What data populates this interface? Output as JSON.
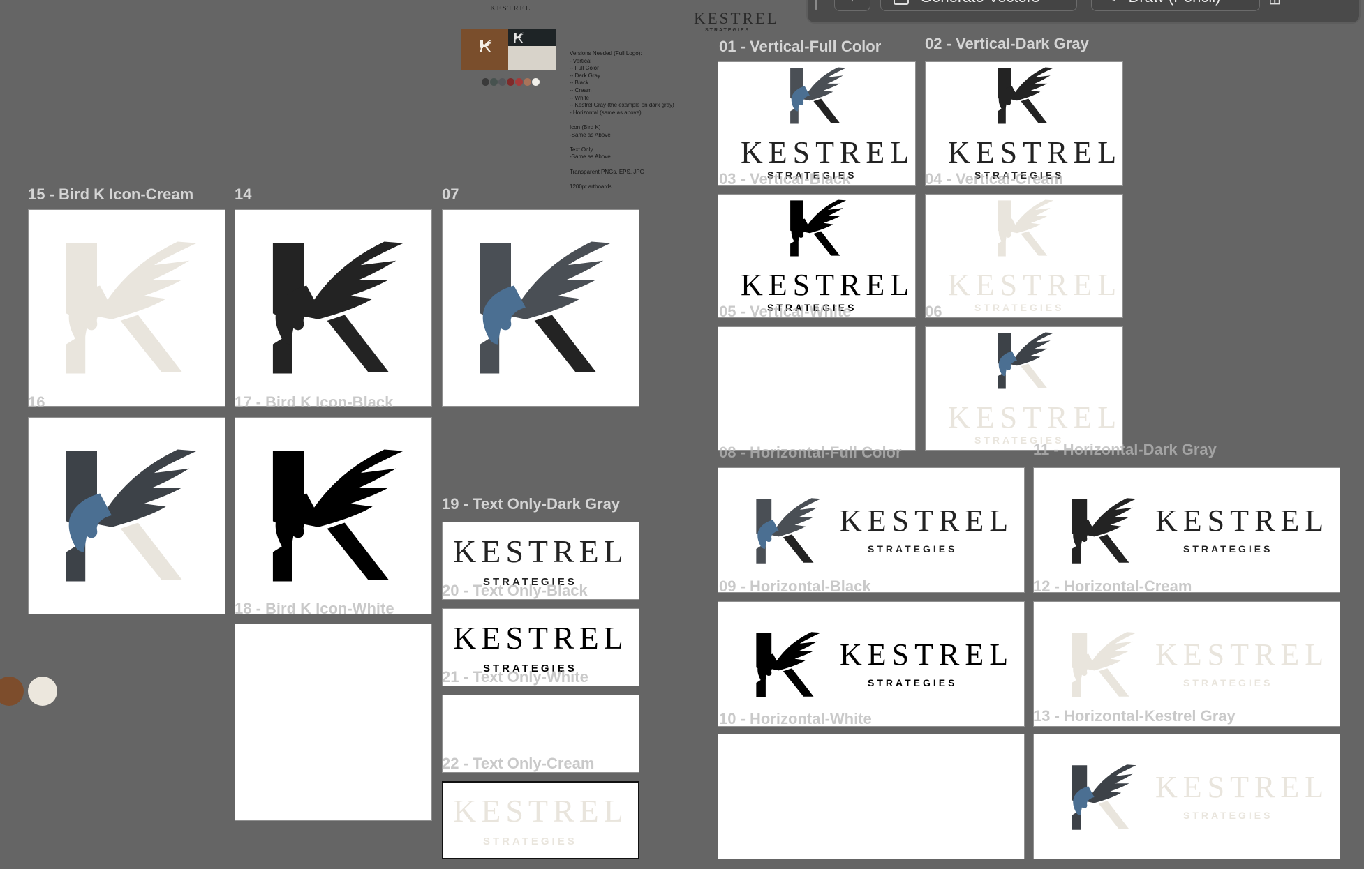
{
  "toolbar": {
    "generate_vectors": "Generate Vectors",
    "draw_pencil": "Draw (Pencil)",
    "more": "•••"
  },
  "brand": {
    "name": "KESTREL",
    "sub": "STRATEGIES",
    "small_sub": "STRATEGIES"
  },
  "notes": "Versions Needed (Full Logo):\n- Vertical\n-- Full Color\n-- Dark Gray\n-- Black\n-- Cream\n-- White\n-- Kestrel Gray (the example on dark gray)\n- Horizontal (same as above)\n\nIcon (Bird K)\n-Same as Above\n\nText Only\n-Same as Above\n\nTransparent PNGs, EPS, JPG\n\n1200pt artboards",
  "palette": [
    "#3a3a3a",
    "#47524f",
    "#55565a",
    "#7e2a2a",
    "#a53a3a",
    "#a8735a",
    "#f2f0ea"
  ],
  "colors": {
    "blue": "#4b6f92",
    "slate": "#3d4248",
    "dark": "#232323",
    "black": "#000000",
    "cream": "#e9e5dd",
    "canvas": "#656565"
  },
  "labels": {
    "l01": "01 - Vertical-Full Color",
    "l02": "02 - Vertical-Dark Gray",
    "l03": "03 - Vertical-Black",
    "l04": "04 - Vertical-Cream",
    "l05": "05 - Vertical-White",
    "l06": "06",
    "l07": "07",
    "l08": "08 - Horizontal-Full Color",
    "l09": "09 - Horizontal-Black",
    "l10": "10 - Horizontal-White",
    "l11": "11 - Horizontal-Dark Gray",
    "l12": "12 - Horizontal-Cream",
    "l13": "13 - Horizontal-Kestrel Gray",
    "l14": "14",
    "l15": "15 - Bird K Icon-Cream",
    "l16": "16",
    "l17": "17 - Bird K Icon-Black",
    "l18": "18 - Bird K Icon-White",
    "l19": "19 - Text Only-Dark Gray",
    "l20": "20 - Text Only-Black",
    "l21": "21 - Text Only-White",
    "l22": "22 - Text Only-Cream"
  }
}
